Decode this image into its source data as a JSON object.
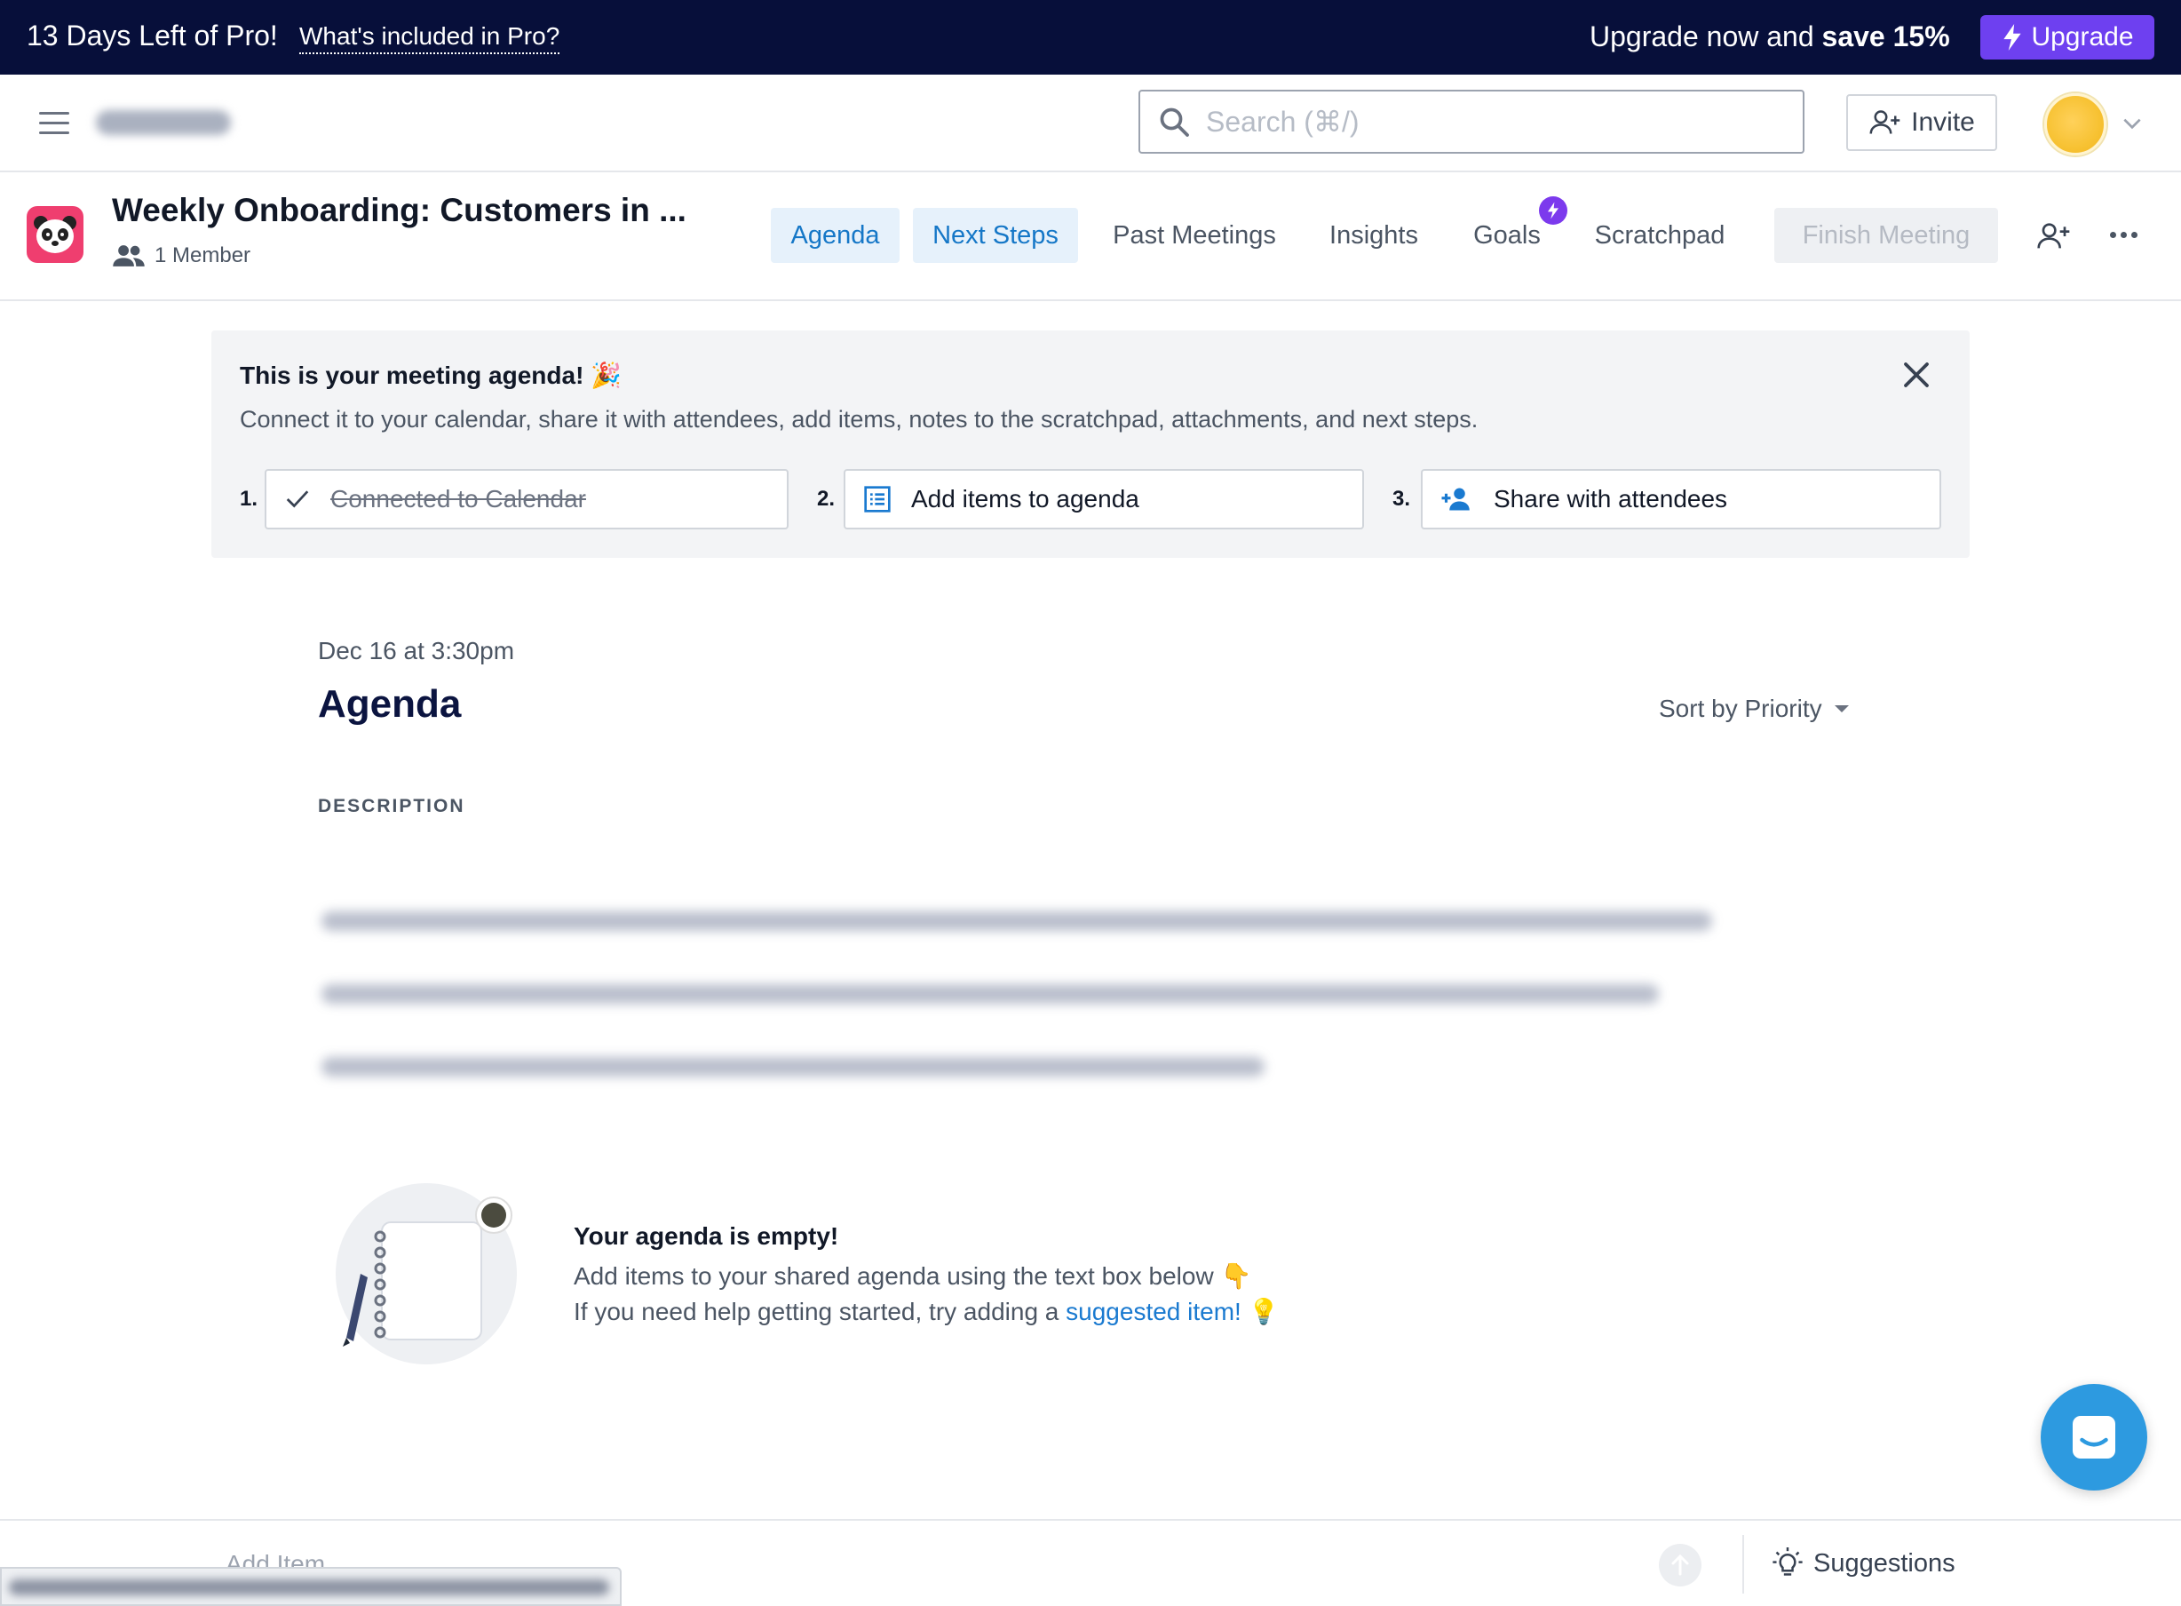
{
  "promo": {
    "days_left": "13 Days Left of Pro!",
    "included_link": "What's included in Pro?",
    "save_prefix": "Upgrade now and ",
    "save_bold": "save 15%",
    "upgrade_label": "Upgrade"
  },
  "topbar": {
    "search_placeholder": "Search (⌘/)",
    "invite_label": "Invite"
  },
  "meeting": {
    "title": "Weekly Onboarding: Customers in ...",
    "members": "1 Member",
    "tabs": [
      {
        "label": "Agenda"
      },
      {
        "label": "Next Steps"
      },
      {
        "label": "Past Meetings"
      },
      {
        "label": "Insights"
      },
      {
        "label": "Goals"
      },
      {
        "label": "Scratchpad"
      }
    ],
    "finish_label": "Finish Meeting"
  },
  "onboarding": {
    "title": "This is your meeting agenda! 🎉",
    "description": "Connect it to your calendar, share it with attendees, add items, notes to the scratchpad, attachments, and next steps.",
    "steps": [
      {
        "num": "1.",
        "label": "Connected to Calendar",
        "done": true
      },
      {
        "num": "2.",
        "label": "Add items to agenda",
        "done": false
      },
      {
        "num": "3.",
        "label": "Share with attendees",
        "done": false
      }
    ]
  },
  "agenda": {
    "date": "Dec 16 at 3:30pm",
    "heading": "Agenda",
    "sort_label": "Sort by Priority",
    "description_label": "DESCRIPTION",
    "empty_title": "Your agenda is empty!",
    "empty_line1": "Add items to your shared agenda using the text box below 👇",
    "empty_line2_prefix": "If you need help getting started, try adding a ",
    "empty_line2_link": "suggested item!",
    "empty_line2_suffix": " 💡"
  },
  "bottombar": {
    "add_item_placeholder": "Add Item",
    "suggestions_label": "Suggestions"
  },
  "colors": {
    "promo_bg": "#070f3a",
    "upgrade_purple": "#6e40f0",
    "accent_blue": "#1577c7",
    "panda_bg": "#ef3e6f",
    "chat_blue": "#2d9ae0"
  }
}
